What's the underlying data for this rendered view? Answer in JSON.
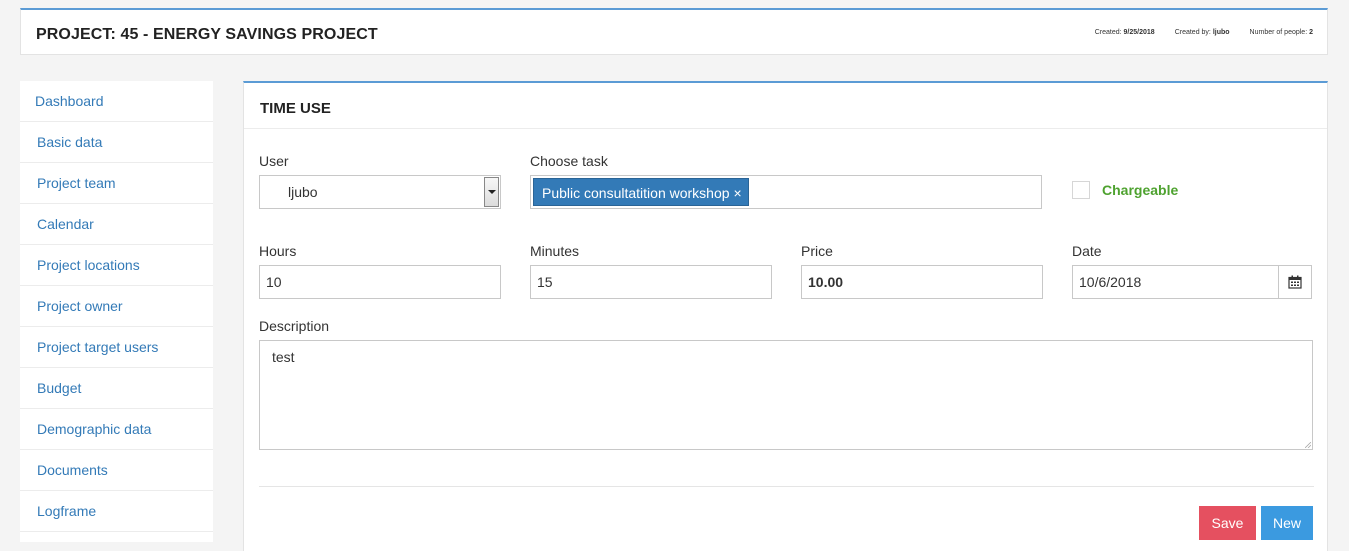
{
  "header": {
    "title": "PROJECT: 45 - ENERGY SAVINGS PROJECT",
    "created_label": "Created:",
    "created_value": "9/25/2018",
    "created_by_label": "Created by:",
    "created_by_value": "ljubo",
    "people_label": "Number of people:",
    "people_value": "2"
  },
  "sidebar": {
    "items": [
      {
        "label": "Dashboard"
      },
      {
        "label": "Basic data"
      },
      {
        "label": "Project team"
      },
      {
        "label": "Calendar"
      },
      {
        "label": "Project locations"
      },
      {
        "label": "Project owner"
      },
      {
        "label": "Project target users"
      },
      {
        "label": "Budget"
      },
      {
        "label": "Demographic data"
      },
      {
        "label": "Documents"
      },
      {
        "label": "Logframe"
      }
    ]
  },
  "form": {
    "title": "TIME USE",
    "user_label": "User",
    "user_value": "ljubo",
    "task_label": "Choose task",
    "task_tag": "Public consultatition workshop",
    "task_tag_remove": "×",
    "chargeable_label": "Chargeable",
    "chargeable_checked": false,
    "hours_label": "Hours",
    "hours_value": "10",
    "minutes_label": "Minutes",
    "minutes_value": "15",
    "price_label": "Price",
    "price_value": "10.00",
    "date_label": "Date",
    "date_value": "10/6/2018",
    "description_label": "Description",
    "description_value": "test",
    "save_label": "Save",
    "new_label": "New"
  },
  "colors": {
    "accent": "#5b9bd5",
    "link": "#337ab7",
    "save": "#e55060",
    "new": "#3b9ae0",
    "chargeable": "#4ea22f"
  }
}
